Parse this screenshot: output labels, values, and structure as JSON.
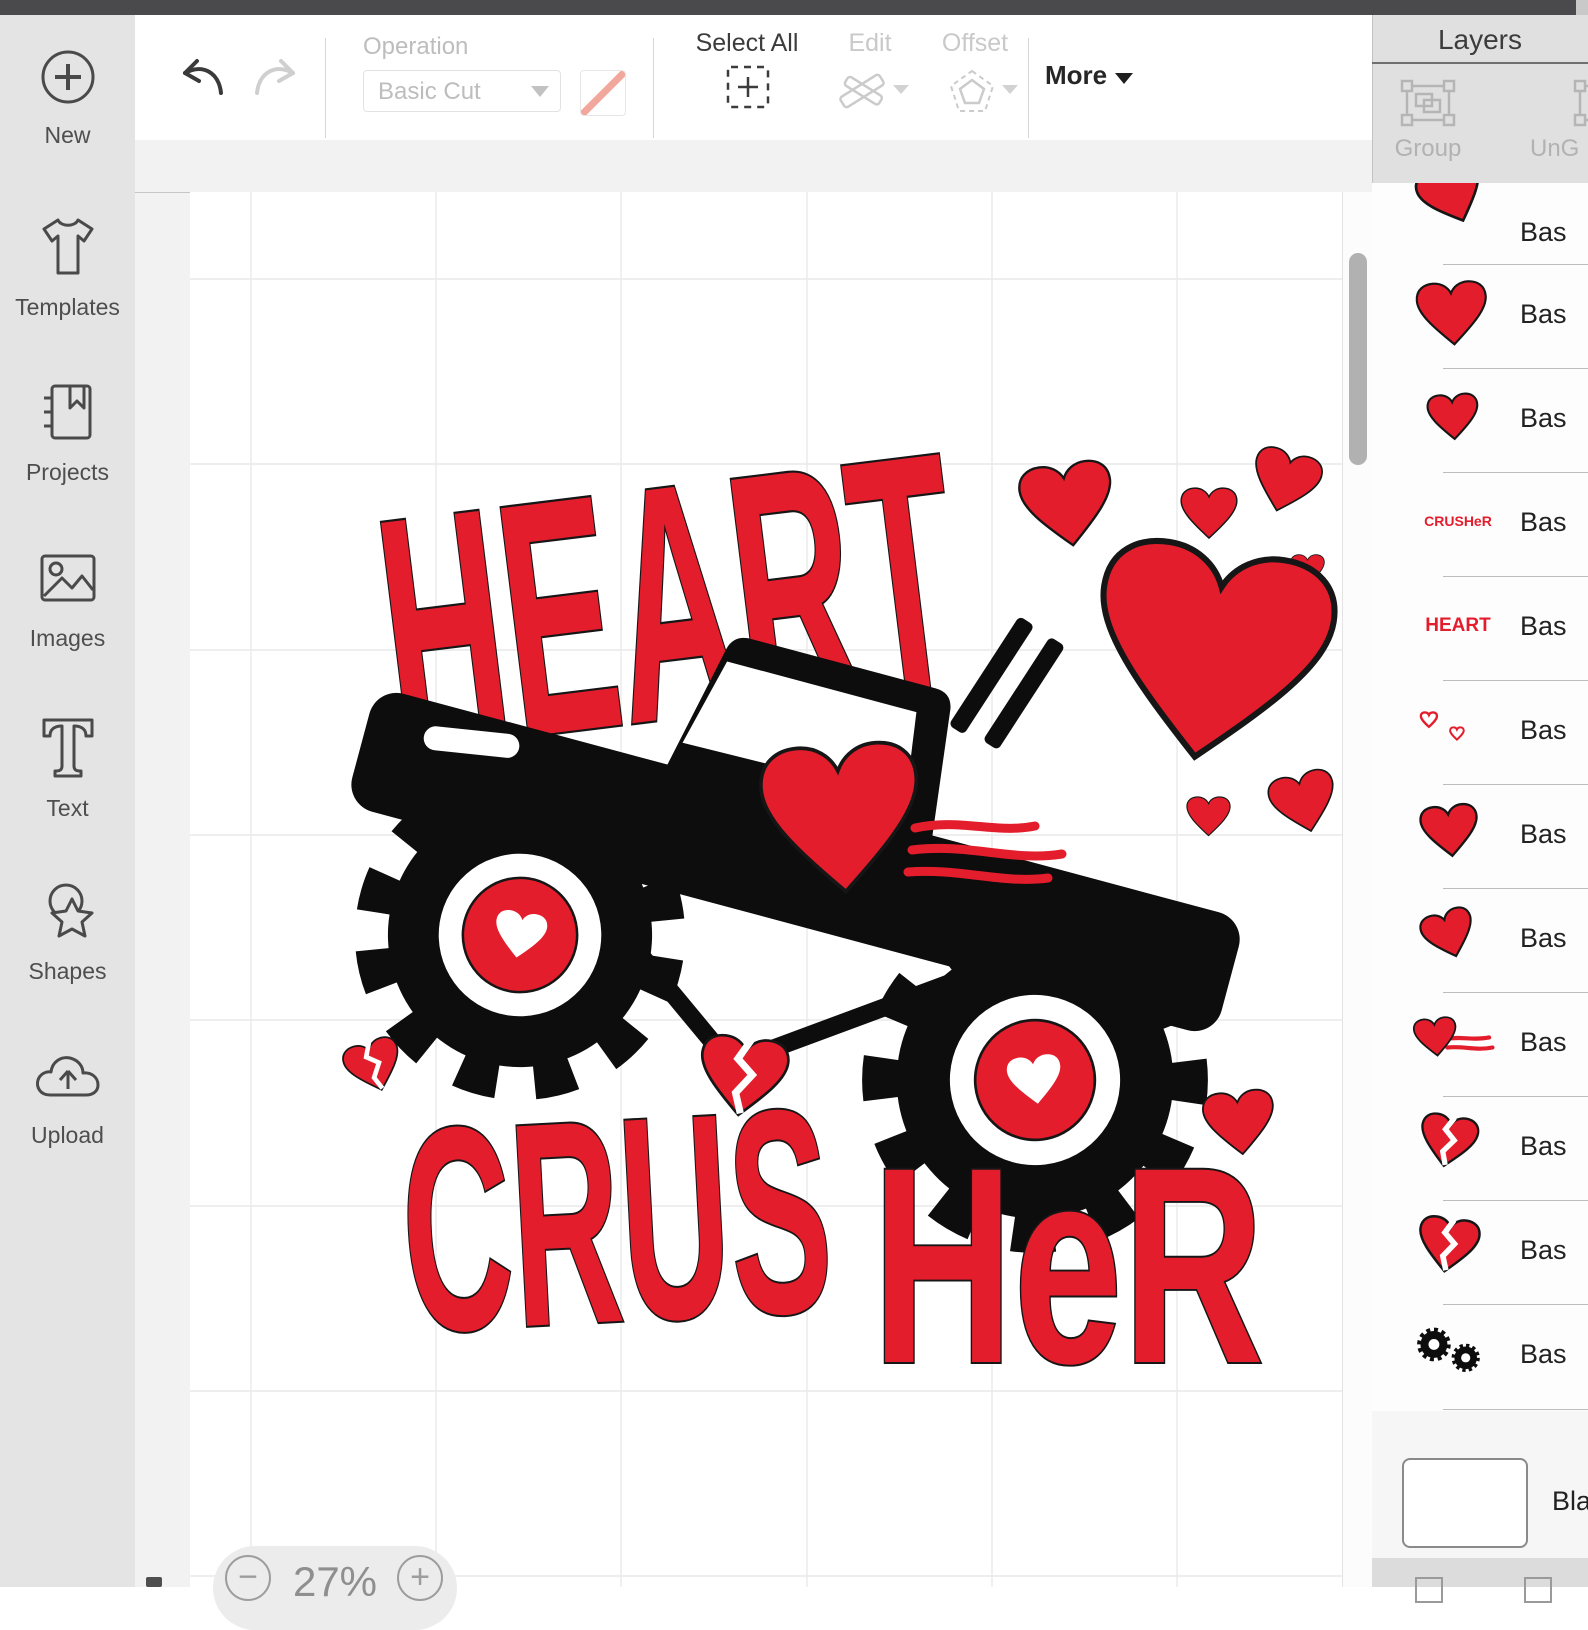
{
  "toolbar": {
    "operation_label": "Operation",
    "operation_value": "Basic Cut",
    "select_all": "Select All",
    "edit": "Edit",
    "offset": "Offset",
    "more": "More"
  },
  "sidebar": {
    "items": [
      {
        "icon": "plus-circle-icon",
        "label": "New"
      },
      {
        "icon": "tshirt-icon",
        "label": "Templates"
      },
      {
        "icon": "notebook-icon",
        "label": "Projects"
      },
      {
        "icon": "image-icon",
        "label": "Images"
      },
      {
        "icon": "text-icon",
        "label": "Text"
      },
      {
        "icon": "shapes-icon",
        "label": "Shapes"
      },
      {
        "icon": "upload-cloud-icon",
        "label": "Upload"
      }
    ]
  },
  "canvas": {
    "zoom": "27%",
    "word_top": "HEART",
    "word_bottom_left": "CRUS",
    "word_bottom_right": "HeR",
    "design_red": "#e41d2c",
    "design_black": "#0d0d0d"
  },
  "layers_panel": {
    "title": "Layers",
    "group_label": "Group",
    "ungroup_label": "UnG",
    "rows": [
      {
        "icon": "heart-thumb",
        "label": "Bas"
      },
      {
        "icon": "heart-thumb",
        "label": "Bas"
      },
      {
        "icon": "heart-thumb",
        "label": "Bas"
      },
      {
        "icon": "crusher-word-thumb",
        "label": "Bas",
        "thumb_text": "CRUSHeR"
      },
      {
        "icon": "heart-word-thumb",
        "label": "Bas",
        "thumb_text": "HEART"
      },
      {
        "icon": "tiny-hearts-outline-thumb",
        "label": "Bas"
      },
      {
        "icon": "heart-thumb",
        "label": "Bas"
      },
      {
        "icon": "heart-thumb",
        "label": "Bas"
      },
      {
        "icon": "flame-heart-thumb",
        "label": "Bas"
      },
      {
        "icon": "broken-heart-thumb",
        "label": "Bas"
      },
      {
        "icon": "broken-heart-thumb",
        "label": "Bas"
      },
      {
        "icon": "gears-thumb",
        "label": "Bas"
      }
    ],
    "mat": {
      "icon": "blank-canvas-thumb",
      "label": "Bla"
    }
  },
  "colors": {
    "accent_red": "#e41d2c",
    "operation_swatch": "#f2a79c",
    "top_bar": "#4a4a4c"
  }
}
